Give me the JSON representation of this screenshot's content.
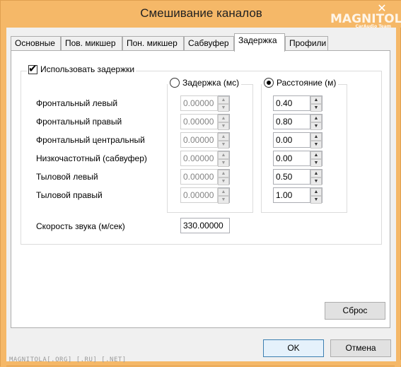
{
  "window": {
    "title": "Смешивание каналов",
    "close_glyph": "✕"
  },
  "watermark": {
    "logo": "MAGNITOLA",
    "logo_sub": "CarAudio Team",
    "footer": "MAGNITOLA[.ORG] [.RU] [.NET]"
  },
  "tabs": [
    {
      "label": "Основные",
      "active": false
    },
    {
      "label": "Пов. микшер",
      "active": false
    },
    {
      "label": "Пон. микшер",
      "active": false
    },
    {
      "label": "Сабвуфер",
      "active": false
    },
    {
      "label": "Задержка",
      "active": true
    },
    {
      "label": "Профили",
      "active": false
    }
  ],
  "delays": {
    "use_label": "Использовать задержки",
    "use_checked": true,
    "mode_delay_label": "Задержка (мс)",
    "mode_distance_label": "Расстояние (м)",
    "selected_mode": "distance",
    "channels": [
      {
        "name": "Фронтальный левый",
        "delay_ms": "0.00000",
        "distance_m": "0.40"
      },
      {
        "name": "Фронтальный правый",
        "delay_ms": "0.00000",
        "distance_m": "0.80"
      },
      {
        "name": "Фронтальный центральный",
        "delay_ms": "0.00000",
        "distance_m": "0.00"
      },
      {
        "name": "Низкочастотный (сабвуфер)",
        "delay_ms": "0.00000",
        "distance_m": "0.00"
      },
      {
        "name": "Тыловой левый",
        "delay_ms": "0.00000",
        "distance_m": "0.50"
      },
      {
        "name": "Тыловой правый",
        "delay_ms": "0.00000",
        "distance_m": "1.00"
      }
    ],
    "speed_label": "Скорость звука (м/сек)",
    "speed_value": "330.00000"
  },
  "buttons": {
    "reset": "Сброс",
    "ok": "OK",
    "cancel": "Отмена"
  },
  "icons": {
    "spin_up": "▲",
    "spin_down": "▼",
    "check": "✔"
  }
}
